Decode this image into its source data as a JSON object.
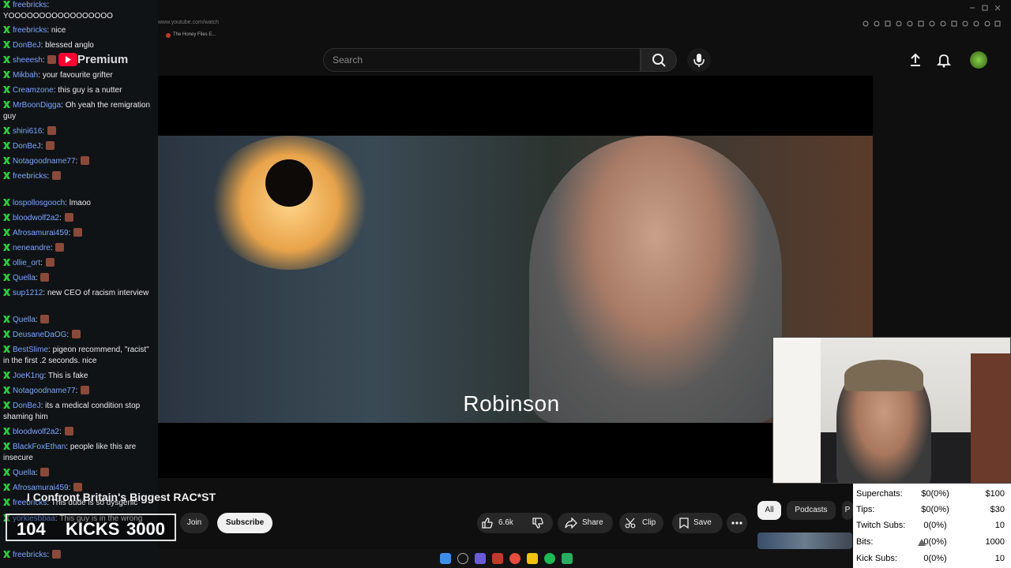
{
  "chat": {
    "messages": [
      {
        "user": "freebricks",
        "text": "YOOOOOOOOOOOOOOOOO"
      },
      {
        "user": "freebricks",
        "text": "nice"
      },
      {
        "user": "DonBeJ",
        "text": "blessed anglo"
      },
      {
        "user": "sheeesh",
        "text": ""
      },
      {
        "user": "Mikbah",
        "text": "your favourite grifter"
      },
      {
        "user": "Creamzone",
        "text": "this guy is a nutter"
      },
      {
        "user": "MrBoonDigga",
        "text": "Oh yeah the remigration guy"
      },
      {
        "user": "shini616",
        "text": ""
      },
      {
        "user": "DonBeJ",
        "text": ""
      },
      {
        "user": "Notagoodname77",
        "text": ""
      },
      {
        "user": "freebricks",
        "text": ""
      },
      {
        "user": "lospollosgooch",
        "text": "lmaoo"
      },
      {
        "user": "bloodwolf2a2",
        "text": ""
      },
      {
        "user": "Afrosamurai459",
        "text": ""
      },
      {
        "user": "neneandre",
        "text": ""
      },
      {
        "user": "ollie_ort",
        "text": ""
      },
      {
        "user": "Quella",
        "text": ""
      },
      {
        "user": "sup1212",
        "text": "new CEO of racism interview"
      },
      {
        "user": "Quella",
        "text": ""
      },
      {
        "user": "DeusaneDaOG",
        "text": ""
      },
      {
        "user": "BestSlime",
        "text": "pigeon recommend, \"racist\" in the first .2 seconds. nice"
      },
      {
        "user": "JoeK1ng",
        "text": "This is fake"
      },
      {
        "user": "Notagoodname77",
        "text": ""
      },
      {
        "user": "DonBeJ",
        "text": "its a medical condition stop shaming him"
      },
      {
        "user": "bloodwolf2a2",
        "text": ""
      },
      {
        "user": "BlackFoxEthan",
        "text": "people like this are insecure"
      },
      {
        "user": "Quella",
        "text": ""
      },
      {
        "user": "Afrosamurai459",
        "text": ""
      },
      {
        "user": "freebricks",
        "text": "This dude is so dysgenic"
      },
      {
        "user": "yorkiesbbaa",
        "text": "This guy is in the wrong"
      },
      {
        "user": "freebricks",
        "text": ""
      }
    ]
  },
  "browser": {
    "address": "www.youtube.com/watch",
    "bookmark": "The Honey Files E..."
  },
  "youtube": {
    "logo": "Premium",
    "search_placeholder": "Search",
    "video_subtitle": "Robinson",
    "video_title": "I Confront Britain's Biggest RAC*ST",
    "join_label": "Join",
    "subscribe_label": "Subscribe",
    "like_count": "6.6k",
    "share_label": "Share",
    "clip_label": "Clip",
    "save_label": "Save",
    "chips": [
      "All",
      "Podcasts",
      "P"
    ]
  },
  "overlay": {
    "kicks_count": "104",
    "kicks_label": "KICKS",
    "kicks_goal": "3000"
  },
  "stats": {
    "rows": [
      {
        "label": "Superchats:",
        "value": "$0(0%)",
        "goal": "$100"
      },
      {
        "label": "Tips:",
        "value": "$0(0%)",
        "goal": "$30"
      },
      {
        "label": "Twitch Subs:",
        "value": "0(0%)",
        "goal": "10"
      },
      {
        "label": "Bits:",
        "value": "0(0%)",
        "goal": "1000"
      },
      {
        "label": "Kick Subs:",
        "value": "0(0%)",
        "goal": "10"
      }
    ]
  },
  "colors": {
    "chat_badge": "#2ecc40",
    "chat_user": "#7aa7ff",
    "yt_background": "#0f0f0f"
  }
}
